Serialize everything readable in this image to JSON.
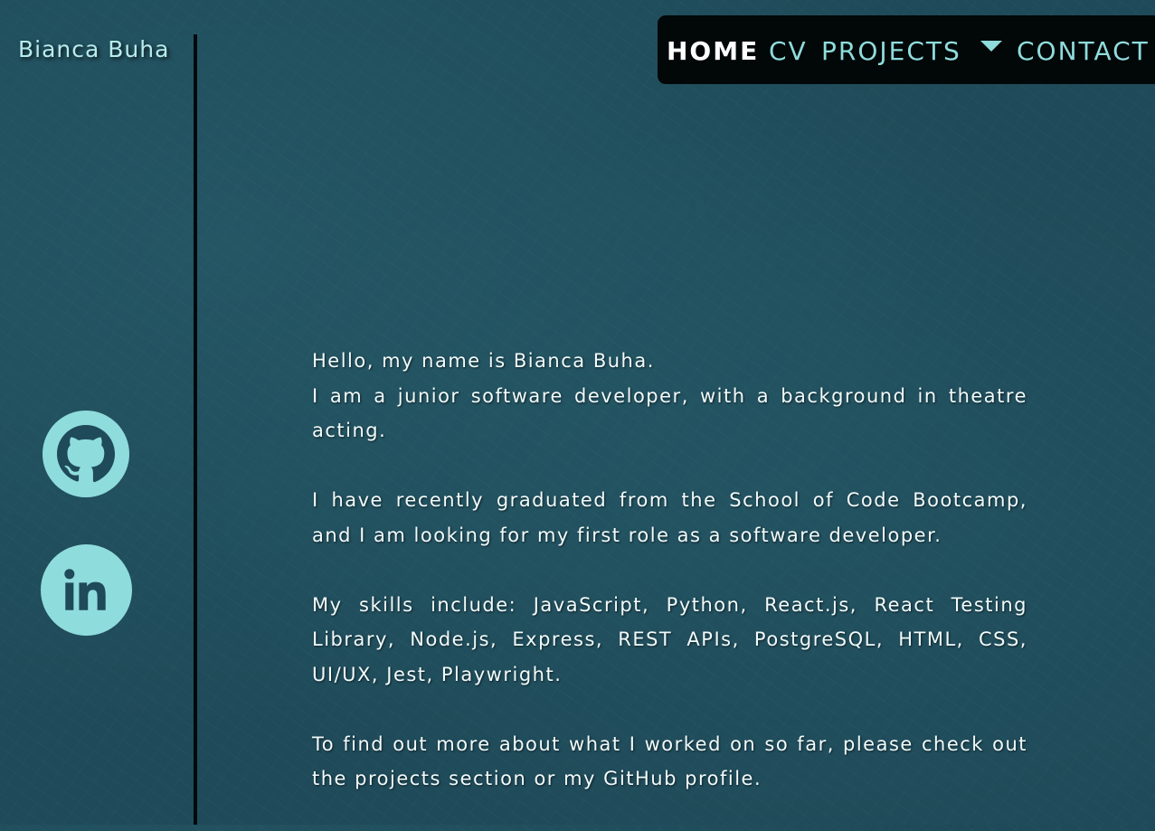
{
  "sidebar": {
    "name": "Bianca Buha",
    "social": [
      {
        "label": "GitHub",
        "icon": "github-icon"
      },
      {
        "label": "LinkedIn",
        "icon": "linkedin-icon"
      }
    ]
  },
  "nav": {
    "items": [
      {
        "label": "HOME",
        "active": true
      },
      {
        "label": "CV",
        "active": false
      },
      {
        "label": "PROJECTS",
        "active": false,
        "dropdown_icon": "caret-down-icon"
      },
      {
        "label": "CONTACT",
        "active": false
      }
    ]
  },
  "main": {
    "greeting": "Hello, my name is Bianca Buha.",
    "intro": "I am a junior software developer, with a background in theatre acting.",
    "graduation": "I have recently graduated from the School of Code Bootcamp, and I am looking for my first role as a software developer.",
    "skills": "My skills include: JavaScript, Python, React.js, React Testing Library, Node.js, Express, REST APIs, PostgreSQL, HTML, CSS, UI/UX, Jest, Playwright.",
    "more_info": "To find out more about what I worked on so far, please check out the projects section or my GitHub profile."
  },
  "colors": {
    "background": "#1f4a59",
    "accent": "#8fdcdc",
    "nav_background": "#020708",
    "text": "#f1fbfb"
  }
}
